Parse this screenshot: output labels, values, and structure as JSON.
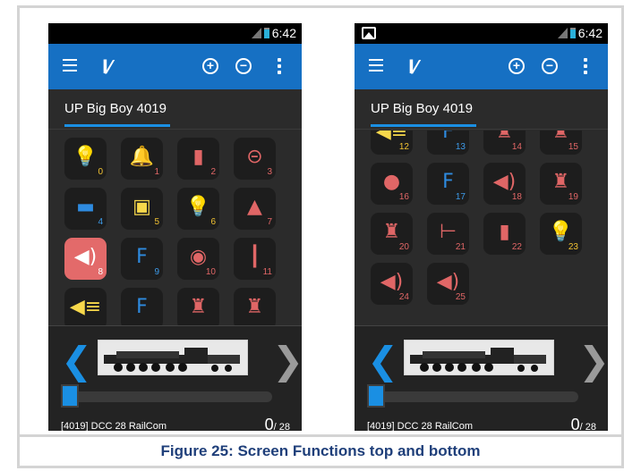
{
  "caption": "Figure 25: Screen Functions top and bottom",
  "status_time": "6:42",
  "app_logo": "l⁄",
  "loco_tab": "UP Big Boy 4019",
  "address_line": "[4019]  DCC 28 RailCom",
  "speed_value": "0",
  "speed_max": "/ 28",
  "colors": {
    "app_bar": "#1670c3",
    "accent": "#1a8fe3",
    "active_function": "#e36a6a",
    "function_yellow": "#f7d84b",
    "function_red": "#e06666",
    "function_blue": "#2e8be0"
  },
  "left_functions": [
    {
      "num": "0",
      "icon": "lightbulb-icon",
      "glyph": "💡",
      "color": "y"
    },
    {
      "num": "1",
      "icon": "bell-icon",
      "glyph": "🔔",
      "color": "r"
    },
    {
      "num": "2",
      "icon": "whistle-icon",
      "glyph": "▮",
      "color": "r"
    },
    {
      "num": "3",
      "icon": "coupler-icon",
      "glyph": "⊝",
      "color": "r"
    },
    {
      "num": "4",
      "icon": "fuel-tank-icon",
      "glyph": "▬",
      "color": "b"
    },
    {
      "num": "5",
      "icon": "cab-icon",
      "glyph": "▣",
      "color": "y"
    },
    {
      "num": "6",
      "icon": "numbered-light-icon",
      "glyph": "💡",
      "color": "y"
    },
    {
      "num": "7",
      "icon": "sander-icon",
      "glyph": "▲",
      "color": "r"
    },
    {
      "num": "8",
      "icon": "speaker-icon",
      "glyph": "◀)",
      "color": "w"
    },
    {
      "num": "9",
      "icon": "function-f-icon",
      "glyph": "F",
      "color": "b"
    },
    {
      "num": "10",
      "icon": "brake-disc-icon",
      "glyph": "◉",
      "color": "r"
    },
    {
      "num": "11",
      "icon": "shovel-icon",
      "glyph": "┃",
      "color": "r"
    },
    {
      "num": "",
      "icon": "headlight-icon",
      "glyph": "◀≡",
      "color": "y"
    },
    {
      "num": "",
      "icon": "function-f-icon",
      "glyph": "F",
      "color": "b"
    },
    {
      "num": "",
      "icon": "valve-icon",
      "glyph": "♜",
      "color": "r"
    },
    {
      "num": "",
      "icon": "valve-icon",
      "glyph": "♜",
      "color": "r"
    }
  ],
  "right_functions": [
    {
      "num": "12",
      "icon": "headlight-icon",
      "glyph": "◀≡",
      "color": "y"
    },
    {
      "num": "13",
      "icon": "function-f-icon",
      "glyph": "F",
      "color": "b"
    },
    {
      "num": "14",
      "icon": "valve-icon",
      "glyph": "♜",
      "color": "r"
    },
    {
      "num": "15",
      "icon": "valve-icon",
      "glyph": "♜",
      "color": "r"
    },
    {
      "num": "16",
      "icon": "water-drop-icon",
      "glyph": "●",
      "color": "r"
    },
    {
      "num": "17",
      "icon": "function-f-icon",
      "glyph": "F",
      "color": "b"
    },
    {
      "num": "18",
      "icon": "speaker-plus-icon",
      "glyph": "◀)",
      "color": "r"
    },
    {
      "num": "19",
      "icon": "steam-release-icon",
      "glyph": "♜",
      "color": "r"
    },
    {
      "num": "20",
      "icon": "steam-release-icon",
      "glyph": "♜",
      "color": "r"
    },
    {
      "num": "21",
      "icon": "horn-icon",
      "glyph": "⊢",
      "color": "r"
    },
    {
      "num": "22",
      "icon": "whistle-icon",
      "glyph": "▮",
      "color": "r"
    },
    {
      "num": "23",
      "icon": "lightbulb-icon",
      "glyph": "💡",
      "color": "y"
    },
    {
      "num": "24",
      "icon": "speaker-icon",
      "glyph": "◀)",
      "color": "r"
    },
    {
      "num": "25",
      "icon": "speaker-icon",
      "glyph": "◀)",
      "color": "r"
    }
  ]
}
